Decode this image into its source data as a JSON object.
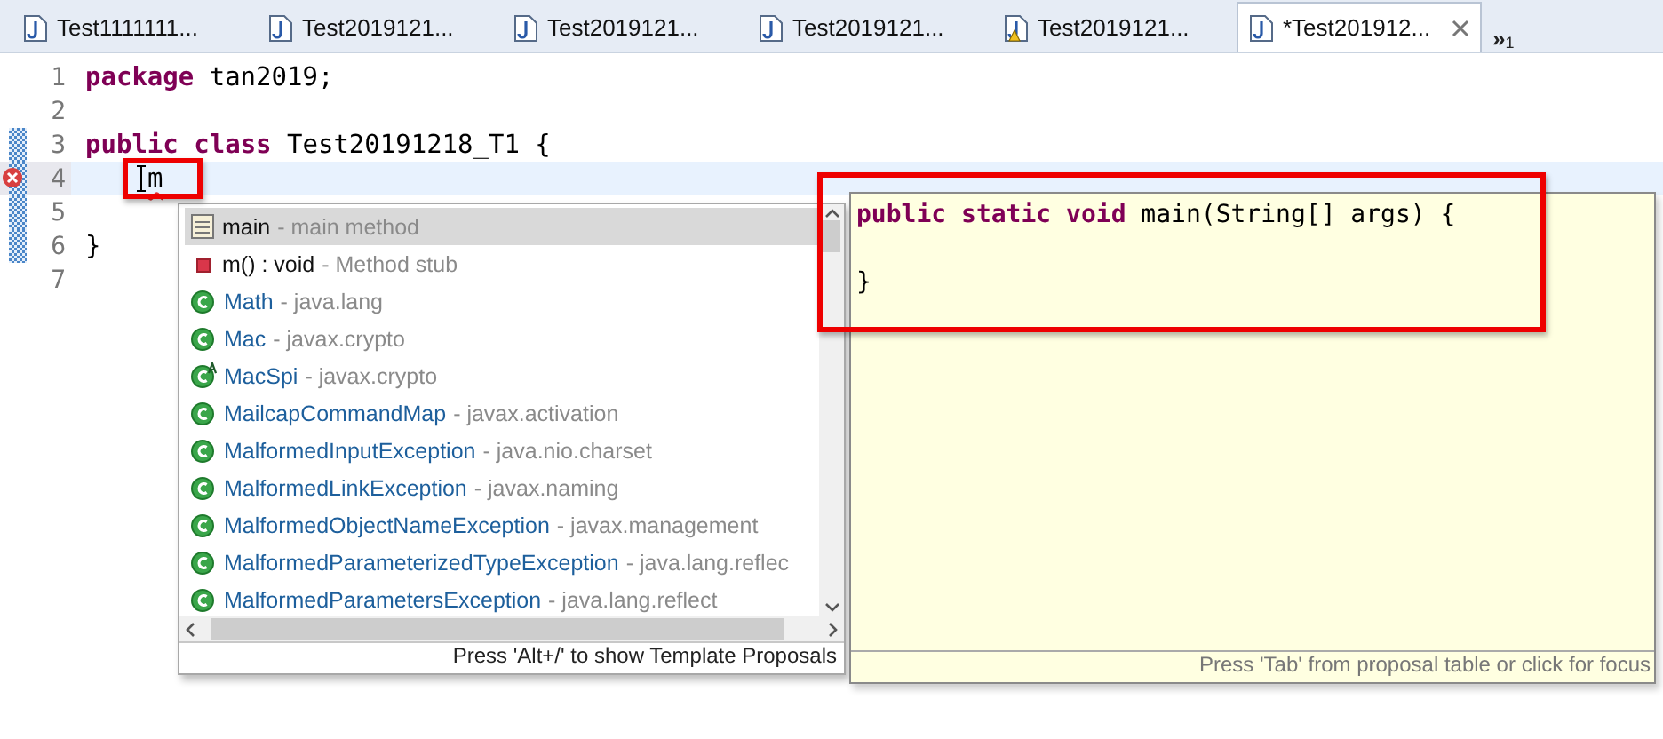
{
  "tabs": [
    {
      "label": "Test1111111...",
      "selected": false,
      "warning": false
    },
    {
      "label": "Test2019121...",
      "selected": false,
      "warning": false
    },
    {
      "label": "Test2019121...",
      "selected": false,
      "warning": false
    },
    {
      "label": "Test2019121...",
      "selected": false,
      "warning": false
    },
    {
      "label": "Test2019121...",
      "selected": false,
      "warning": true
    },
    {
      "label": "*Test201912...",
      "selected": true,
      "warning": false
    }
  ],
  "tab_overflow": {
    "symbol": "»",
    "count": "1"
  },
  "editor": {
    "lines": [
      {
        "number": "1",
        "marker": false,
        "error": false,
        "current": false,
        "text": "**package** tan2019;"
      },
      {
        "number": "2",
        "marker": false,
        "error": false,
        "current": false
      },
      {
        "number": "3",
        "marker": true,
        "error": false,
        "current": false,
        "text": "**public** **class** Test20191218_T1 {"
      },
      {
        "number": "4",
        "marker": true,
        "error": true,
        "current": true,
        "indent": true,
        "text": "m"
      },
      {
        "number": "5",
        "marker": true,
        "error": false,
        "current": false
      },
      {
        "number": "6",
        "marker": true,
        "error": false,
        "current": false,
        "text": "}"
      },
      {
        "number": "7",
        "marker": false,
        "error": false,
        "current": false
      }
    ]
  },
  "proposals": {
    "items": [
      {
        "kind": "template",
        "name": "main",
        "qualifier": "- main method",
        "selected": true
      },
      {
        "kind": "method",
        "name": "m() : void",
        "qualifier": "- Method stub",
        "selected": false
      },
      {
        "kind": "class",
        "name": "Math",
        "qualifier": "- java.lang",
        "selected": false
      },
      {
        "kind": "class",
        "name": "Mac",
        "qualifier": "- javax.crypto",
        "selected": false
      },
      {
        "kind": "abstract_class",
        "name": "MacSpi",
        "qualifier": "- javax.crypto",
        "selected": false
      },
      {
        "kind": "class",
        "name": "MailcapCommandMap",
        "qualifier": "- javax.activation",
        "selected": false
      },
      {
        "kind": "class",
        "name": "MalformedInputException",
        "qualifier": "- java.nio.charset",
        "selected": false
      },
      {
        "kind": "class",
        "name": "MalformedLinkException",
        "qualifier": "- javax.naming",
        "selected": false
      },
      {
        "kind": "class",
        "name": "MalformedObjectNameException",
        "qualifier": "- javax.management",
        "selected": false
      },
      {
        "kind": "class",
        "name": "MalformedParameterizedTypeException",
        "qualifier": "- java.lang.reflec",
        "selected": false
      },
      {
        "kind": "class",
        "name": "MalformedParametersException",
        "qualifier": "- java.lang.reflect",
        "selected": false
      }
    ],
    "footer": "Press 'Alt+/' to show Template Proposals"
  },
  "preview": {
    "lines": [
      {
        "text": "**public** **static** **void** main(String[] args) {"
      },
      {
        "text": "}"
      }
    ],
    "footer": "Press 'Tab' from proposal table or click for focus"
  }
}
